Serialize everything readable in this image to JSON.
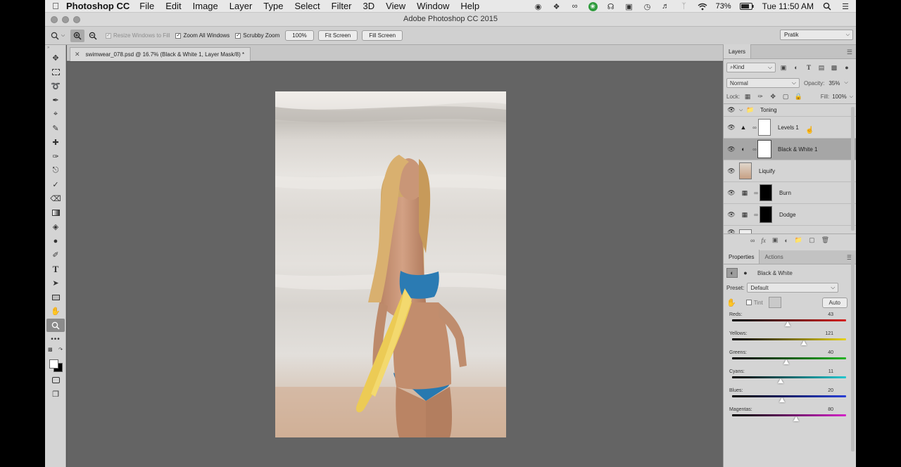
{
  "menubar": {
    "app_name": "Photoshop CC",
    "items": [
      "File",
      "Edit",
      "Image",
      "Layer",
      "Type",
      "Select",
      "Filter",
      "3D",
      "View",
      "Window",
      "Help"
    ],
    "battery": "73%",
    "clock": "Tue 11:50 AM"
  },
  "window": {
    "title": "Adobe Photoshop CC 2015"
  },
  "options": {
    "resize_windows": "Resize Windows to Fill",
    "zoom_all": "Zoom All Windows",
    "scrubby": "Scrubby Zoom",
    "zoom_level": "100%",
    "fit_screen": "Fit Screen",
    "fill_screen": "Fill Screen",
    "workspace": "Pratik"
  },
  "document": {
    "tab_title": "swimwear_078.psd @ 16.7% (Black & White 1, Layer Mask/8) *"
  },
  "layers_panel": {
    "tab": "Layers",
    "kind": "Kind",
    "blend_mode": "Normal",
    "opacity_label": "Opacity:",
    "opacity": "35%",
    "lock_label": "Lock:",
    "fill_label": "Fill:",
    "fill": "100%",
    "group_name": "Toning",
    "layers": [
      {
        "name": "Levels 1"
      },
      {
        "name": "Black & White 1"
      },
      {
        "name": "Liquify"
      },
      {
        "name": "Burn"
      },
      {
        "name": "Dodge"
      }
    ]
  },
  "properties_panel": {
    "tabs": [
      "Properties",
      "Actions"
    ],
    "adjustment": "Black & White",
    "preset_label": "Preset:",
    "preset": "Default",
    "tint": "Tint",
    "auto": "Auto",
    "sliders": [
      {
        "label": "Reds:",
        "value": "43",
        "pos": 0.485,
        "gradient": "linear-gradient(90deg,#000,#d42222)"
      },
      {
        "label": "Yellows:",
        "value": "121",
        "pos": 0.63,
        "gradient": "linear-gradient(90deg,#000,#e6d21e)"
      },
      {
        "label": "Greens:",
        "value": "40",
        "pos": 0.475,
        "gradient": "linear-gradient(90deg,#000,#27b527)"
      },
      {
        "label": "Cyans:",
        "value": "11",
        "pos": 0.425,
        "gradient": "linear-gradient(90deg,#000,#25c7cf)"
      },
      {
        "label": "Blues:",
        "value": "20",
        "pos": 0.44,
        "gradient": "linear-gradient(90deg,#000,#2a3fd6)"
      },
      {
        "label": "Magentas:",
        "value": "80",
        "pos": 0.56,
        "gradient": "linear-gradient(90deg,#000,#d325c7)"
      }
    ]
  }
}
